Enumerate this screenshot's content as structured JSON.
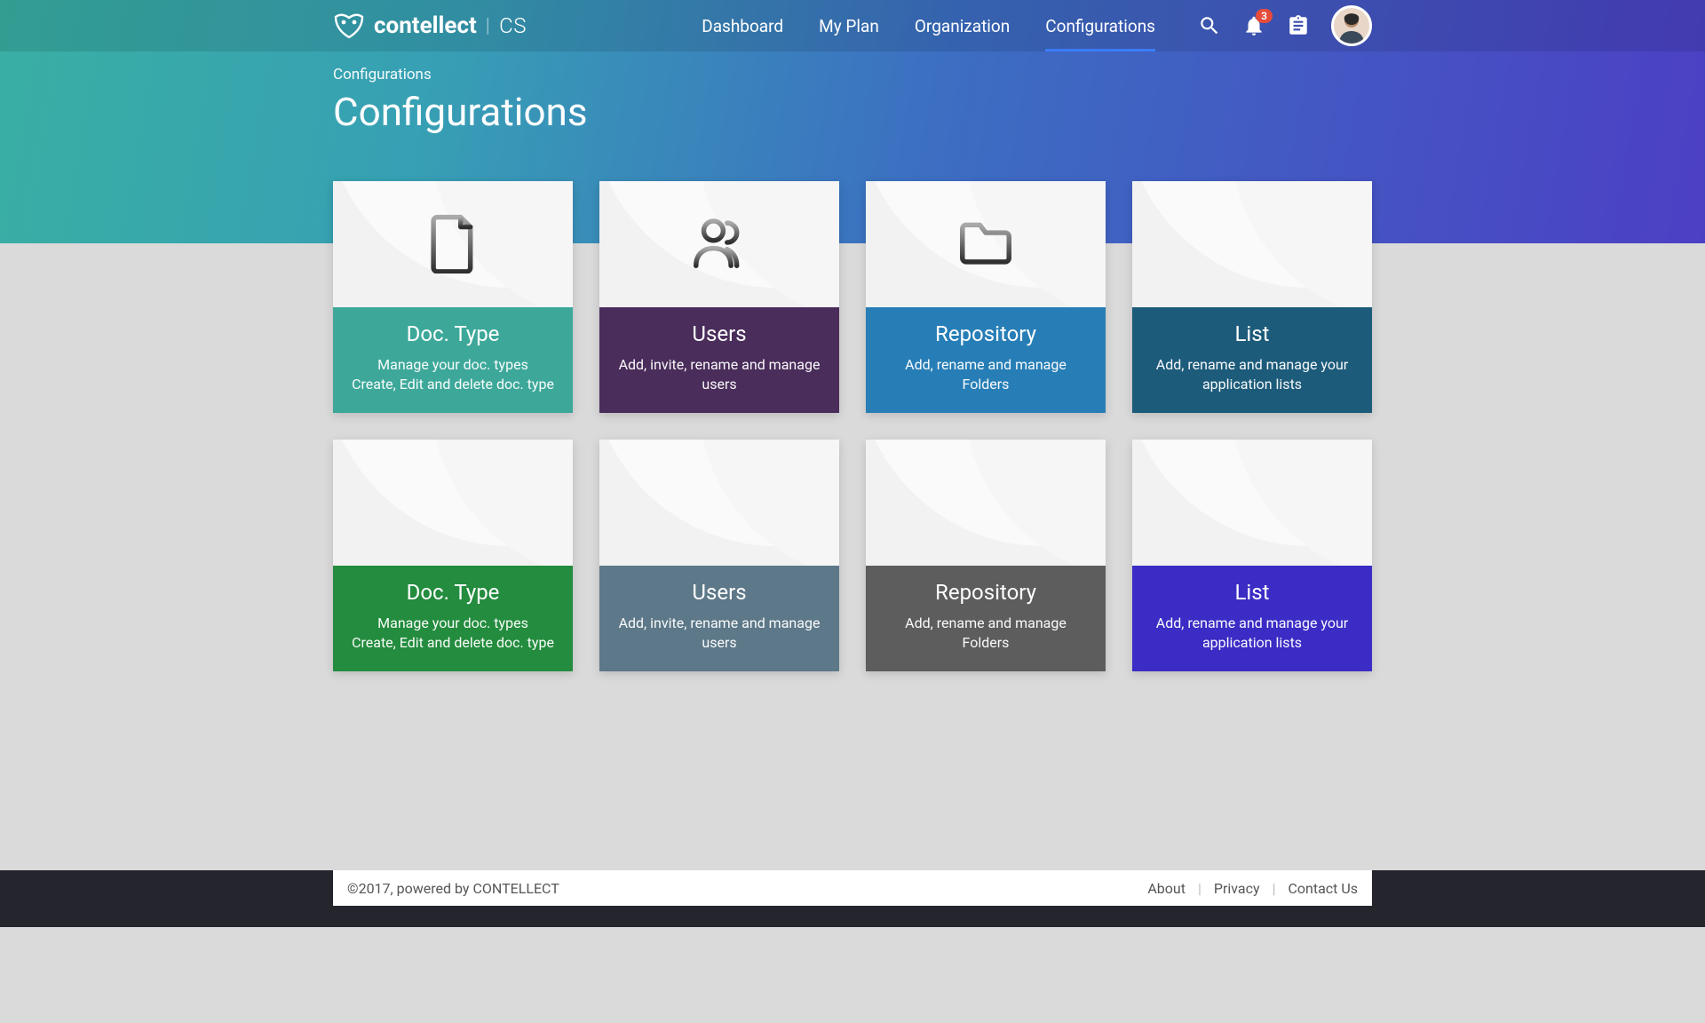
{
  "header": {
    "brand": "contellect",
    "suffix": "CS",
    "nav": {
      "dashboard": "Dashboard",
      "myplan": "My Plan",
      "organization": "Organization",
      "configurations": "Configurations"
    },
    "notifications_count": "3"
  },
  "breadcrumb": "Configurations",
  "page_title": "Configurations",
  "cards": [
    {
      "title": "Doc. Type",
      "desc": "Manage your doc. types\nCreate, Edit and delete doc. type",
      "color": "c-teal",
      "icon": "document-icon"
    },
    {
      "title": "Users",
      "desc": "Add, invite, rename and manage users",
      "color": "c-purple",
      "icon": "users-icon"
    },
    {
      "title": "Repository",
      "desc": "Add, rename and manage Folders",
      "color": "c-blue",
      "icon": "folder-icon"
    },
    {
      "title": "List",
      "desc": "Add, rename and manage your application lists",
      "color": "c-navy",
      "icon": "list-icon"
    },
    {
      "title": "Doc. Type",
      "desc": "Manage your doc. types\nCreate, Edit and delete doc. type",
      "color": "c-green",
      "icon": ""
    },
    {
      "title": "Users",
      "desc": "Add, invite, rename and manage users",
      "color": "c-slate",
      "icon": ""
    },
    {
      "title": "Repository",
      "desc": "Add, rename and manage Folders",
      "color": "c-gray",
      "icon": ""
    },
    {
      "title": "List",
      "desc": "Add, rename and manage your application lists",
      "color": "c-indigo",
      "icon": ""
    }
  ],
  "footer": {
    "copyright": "©2017, powered by CONTELLECT",
    "links": {
      "about": "About",
      "privacy": "Privacy",
      "contact": "Contact Us"
    }
  }
}
